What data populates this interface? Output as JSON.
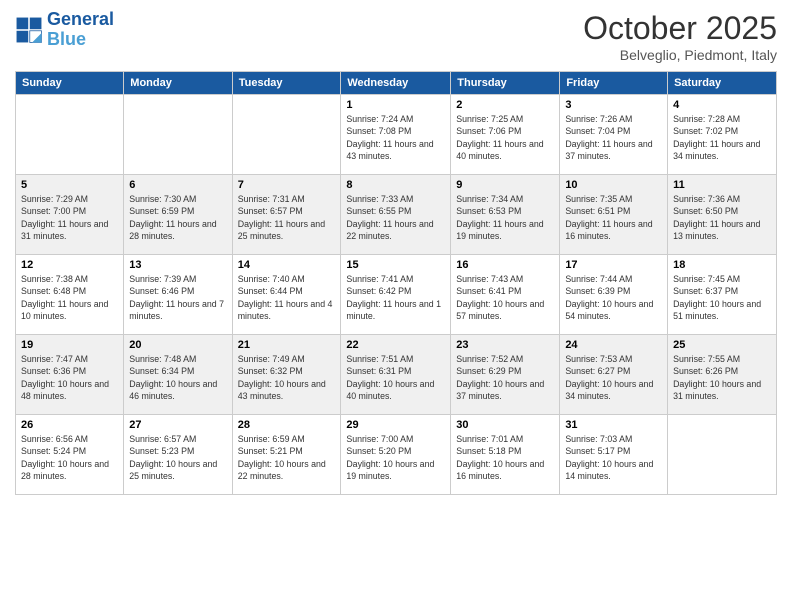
{
  "header": {
    "logo_line1": "General",
    "logo_line2": "Blue",
    "month": "October 2025",
    "location": "Belveglio, Piedmont, Italy"
  },
  "days_of_week": [
    "Sunday",
    "Monday",
    "Tuesday",
    "Wednesday",
    "Thursday",
    "Friday",
    "Saturday"
  ],
  "weeks": [
    [
      null,
      null,
      null,
      {
        "day": 1,
        "sunrise": "7:24 AM",
        "sunset": "7:08 PM",
        "daylight": "11 hours and 43 minutes."
      },
      {
        "day": 2,
        "sunrise": "7:25 AM",
        "sunset": "7:06 PM",
        "daylight": "11 hours and 40 minutes."
      },
      {
        "day": 3,
        "sunrise": "7:26 AM",
        "sunset": "7:04 PM",
        "daylight": "11 hours and 37 minutes."
      },
      {
        "day": 4,
        "sunrise": "7:28 AM",
        "sunset": "7:02 PM",
        "daylight": "11 hours and 34 minutes."
      }
    ],
    [
      {
        "day": 5,
        "sunrise": "7:29 AM",
        "sunset": "7:00 PM",
        "daylight": "11 hours and 31 minutes."
      },
      {
        "day": 6,
        "sunrise": "7:30 AM",
        "sunset": "6:59 PM",
        "daylight": "11 hours and 28 minutes."
      },
      {
        "day": 7,
        "sunrise": "7:31 AM",
        "sunset": "6:57 PM",
        "daylight": "11 hours and 25 minutes."
      },
      {
        "day": 8,
        "sunrise": "7:33 AM",
        "sunset": "6:55 PM",
        "daylight": "11 hours and 22 minutes."
      },
      {
        "day": 9,
        "sunrise": "7:34 AM",
        "sunset": "6:53 PM",
        "daylight": "11 hours and 19 minutes."
      },
      {
        "day": 10,
        "sunrise": "7:35 AM",
        "sunset": "6:51 PM",
        "daylight": "11 hours and 16 minutes."
      },
      {
        "day": 11,
        "sunrise": "7:36 AM",
        "sunset": "6:50 PM",
        "daylight": "11 hours and 13 minutes."
      }
    ],
    [
      {
        "day": 12,
        "sunrise": "7:38 AM",
        "sunset": "6:48 PM",
        "daylight": "11 hours and 10 minutes."
      },
      {
        "day": 13,
        "sunrise": "7:39 AM",
        "sunset": "6:46 PM",
        "daylight": "11 hours and 7 minutes."
      },
      {
        "day": 14,
        "sunrise": "7:40 AM",
        "sunset": "6:44 PM",
        "daylight": "11 hours and 4 minutes."
      },
      {
        "day": 15,
        "sunrise": "7:41 AM",
        "sunset": "6:42 PM",
        "daylight": "11 hours and 1 minute."
      },
      {
        "day": 16,
        "sunrise": "7:43 AM",
        "sunset": "6:41 PM",
        "daylight": "10 hours and 57 minutes."
      },
      {
        "day": 17,
        "sunrise": "7:44 AM",
        "sunset": "6:39 PM",
        "daylight": "10 hours and 54 minutes."
      },
      {
        "day": 18,
        "sunrise": "7:45 AM",
        "sunset": "6:37 PM",
        "daylight": "10 hours and 51 minutes."
      }
    ],
    [
      {
        "day": 19,
        "sunrise": "7:47 AM",
        "sunset": "6:36 PM",
        "daylight": "10 hours and 48 minutes."
      },
      {
        "day": 20,
        "sunrise": "7:48 AM",
        "sunset": "6:34 PM",
        "daylight": "10 hours and 46 minutes."
      },
      {
        "day": 21,
        "sunrise": "7:49 AM",
        "sunset": "6:32 PM",
        "daylight": "10 hours and 43 minutes."
      },
      {
        "day": 22,
        "sunrise": "7:51 AM",
        "sunset": "6:31 PM",
        "daylight": "10 hours and 40 minutes."
      },
      {
        "day": 23,
        "sunrise": "7:52 AM",
        "sunset": "6:29 PM",
        "daylight": "10 hours and 37 minutes."
      },
      {
        "day": 24,
        "sunrise": "7:53 AM",
        "sunset": "6:27 PM",
        "daylight": "10 hours and 34 minutes."
      },
      {
        "day": 25,
        "sunrise": "7:55 AM",
        "sunset": "6:26 PM",
        "daylight": "10 hours and 31 minutes."
      }
    ],
    [
      {
        "day": 26,
        "sunrise": "6:56 AM",
        "sunset": "5:24 PM",
        "daylight": "10 hours and 28 minutes."
      },
      {
        "day": 27,
        "sunrise": "6:57 AM",
        "sunset": "5:23 PM",
        "daylight": "10 hours and 25 minutes."
      },
      {
        "day": 28,
        "sunrise": "6:59 AM",
        "sunset": "5:21 PM",
        "daylight": "10 hours and 22 minutes."
      },
      {
        "day": 29,
        "sunrise": "7:00 AM",
        "sunset": "5:20 PM",
        "daylight": "10 hours and 19 minutes."
      },
      {
        "day": 30,
        "sunrise": "7:01 AM",
        "sunset": "5:18 PM",
        "daylight": "10 hours and 16 minutes."
      },
      {
        "day": 31,
        "sunrise": "7:03 AM",
        "sunset": "5:17 PM",
        "daylight": "10 hours and 14 minutes."
      },
      null
    ]
  ],
  "labels": {
    "sunrise": "Sunrise:",
    "sunset": "Sunset:",
    "daylight": "Daylight:"
  }
}
